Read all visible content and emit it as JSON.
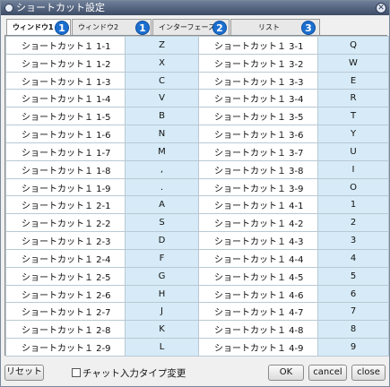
{
  "window": {
    "title": "ショートカット設定",
    "close_glyph": "✕"
  },
  "tabs": [
    {
      "label": "ウィンドウ1",
      "badge": "1"
    },
    {
      "label": "ウィンドウ2",
      "badge": "1"
    },
    {
      "label": "インターフェース",
      "badge": "2"
    },
    {
      "label": "リスト",
      "badge": "3"
    }
  ],
  "rows": [
    [
      "ショートカット１ 1-1",
      "Z",
      "ショートカット１ 3-1",
      "Q"
    ],
    [
      "ショートカット１ 1-2",
      "X",
      "ショートカット１ 3-2",
      "W"
    ],
    [
      "ショートカット１ 1-3",
      "C",
      "ショートカット１ 3-3",
      "E"
    ],
    [
      "ショートカット１ 1-4",
      "V",
      "ショートカット１ 3-4",
      "R"
    ],
    [
      "ショートカット１ 1-5",
      "B",
      "ショートカット１ 3-5",
      "T"
    ],
    [
      "ショートカット１ 1-6",
      "N",
      "ショートカット１ 3-6",
      "Y"
    ],
    [
      "ショートカット１ 1-7",
      "M",
      "ショートカット１ 3-7",
      "U"
    ],
    [
      "ショートカット１ 1-8",
      ",",
      "ショートカット１ 3-8",
      "I"
    ],
    [
      "ショートカット１ 1-9",
      ".",
      "ショートカット１ 3-9",
      "O"
    ],
    [
      "ショートカット１ 2-1",
      "A",
      "ショートカット１ 4-1",
      "1"
    ],
    [
      "ショートカット１ 2-2",
      "S",
      "ショートカット１ 4-2",
      "2"
    ],
    [
      "ショートカット１ 2-3",
      "D",
      "ショートカット１ 4-3",
      "3"
    ],
    [
      "ショートカット１ 2-4",
      "F",
      "ショートカット１ 4-4",
      "4"
    ],
    [
      "ショートカット１ 2-5",
      "G",
      "ショートカット１ 4-5",
      "5"
    ],
    [
      "ショートカット１ 2-6",
      "H",
      "ショートカット１ 4-6",
      "6"
    ],
    [
      "ショートカット１ 2-7",
      "J",
      "ショートカット１ 4-7",
      "7"
    ],
    [
      "ショートカット１ 2-8",
      "K",
      "ショートカット１ 4-8",
      "8"
    ],
    [
      "ショートカット１ 2-9",
      "L",
      "ショートカット１ 4-9",
      "9"
    ]
  ],
  "footer": {
    "reset_label": "リセット",
    "chat_type_label": "チャット入力タイプ変更",
    "ok_label": "OK",
    "cancel_label": "cancel",
    "close_label": "close"
  },
  "colors": {
    "key_cell": "#d6ebf7",
    "titlebar": "#4a5a74",
    "badge": "#1c6fcf"
  }
}
